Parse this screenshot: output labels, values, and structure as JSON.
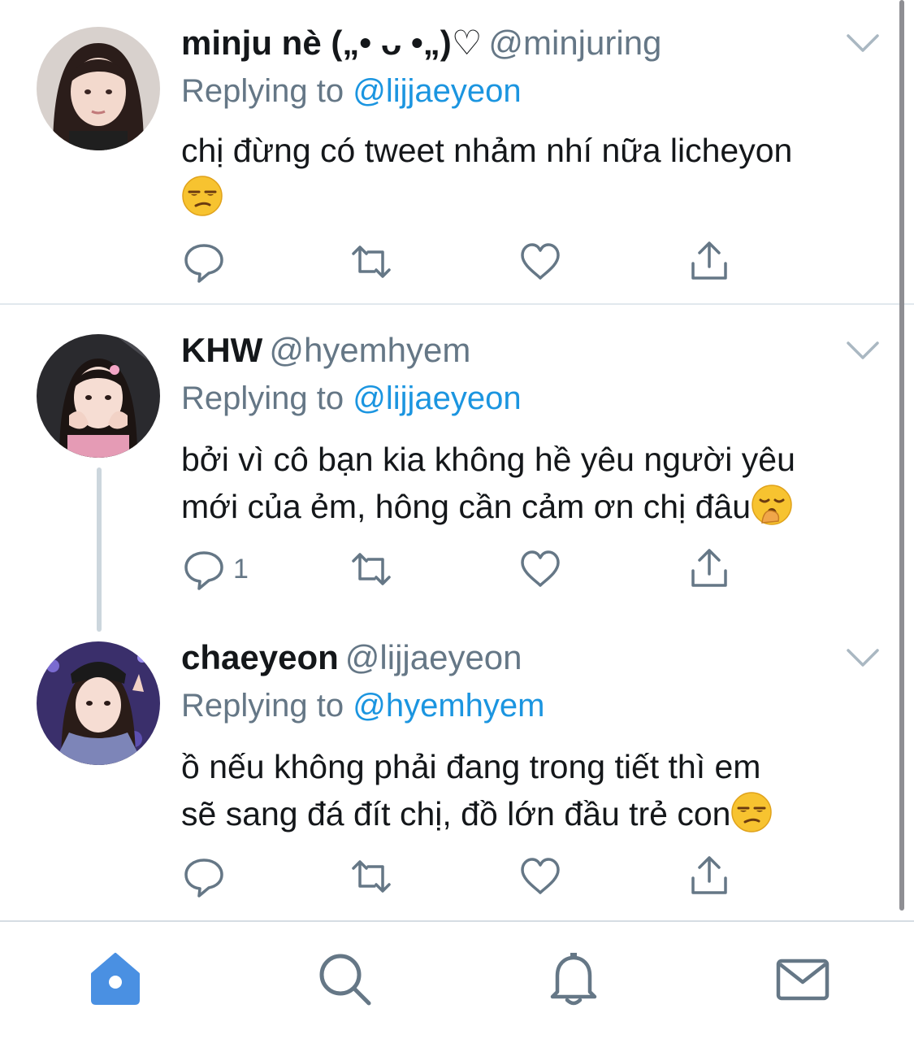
{
  "tweets": [
    {
      "name": "minju nè („• ᴗ •„)♡",
      "handle": "@minjuring",
      "replying_prefix": "Replying to",
      "replying_to": "@lijjaeyeon",
      "lines": [
        "chị đừng có tweet nhảm nhí nữa licheyon",
        ""
      ],
      "emoji": "unamused-face",
      "reply_count": ""
    },
    {
      "name": "KHW",
      "handle": "@hyemhyem",
      "replying_prefix": "Replying to",
      "replying_to": "@lijjaeyeon",
      "lines": [
        "bởi vì cô bạn kia không hề yêu người yêu",
        "mới của ẻm, hông cần cảm ơn chị đâu"
      ],
      "emoji": "yawning-face",
      "reply_count": "1"
    },
    {
      "name": "chaeyeon",
      "handle": "@lijjaeyeon",
      "replying_prefix": "Replying to",
      "replying_to": "@hyemhyem",
      "lines": [
        "ồ nếu không phải đang trong tiết thì em",
        "sẽ sang đá đít chị, đồ lớn đầu trẻ con"
      ],
      "emoji": "unamused-face",
      "reply_count": ""
    }
  ],
  "tabbar": {
    "items": [
      "home-icon",
      "search-icon",
      "notifications-icon",
      "messages-icon"
    ],
    "active": "home-icon"
  },
  "colors": {
    "link": "#1b95e0",
    "secondary_text": "#657786",
    "active_tab": "#4a90e2",
    "inactive_tab": "#657786"
  }
}
